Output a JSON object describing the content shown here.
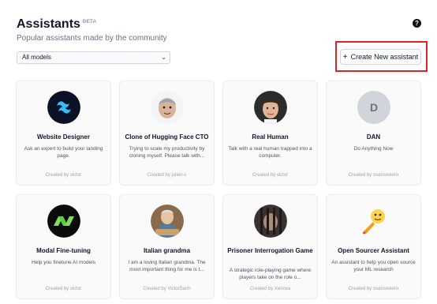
{
  "header": {
    "title": "Assistants",
    "badge": "BETA",
    "subtitle": "Popular assistants made by the community"
  },
  "help_icon": "?",
  "filter": {
    "selected": "All models"
  },
  "create_button": {
    "label": "Create New assistant"
  },
  "cards": [
    {
      "name": "Website Designer",
      "desc": "Ask an expert to build your landing page.",
      "creator": "Created by victor",
      "icon": "tailwind-logo"
    },
    {
      "name": "Clone of Hugging Face CTO",
      "desc": "Trying to scale my productivity by cloning myself. Please talk with...",
      "creator": "Created by julien-c",
      "icon": "memoji-avatar"
    },
    {
      "name": "Real Human",
      "desc": "Talk with a real human trapped into a computer.",
      "creator": "Created by victor",
      "icon": "portrait-photo"
    },
    {
      "name": "DAN",
      "desc": "Do Anything Now",
      "creator": "Created by osanseviero",
      "icon": "letter-avatar",
      "letter": "D"
    },
    {
      "name": "Modal Fine-tuning",
      "desc": "Help you finetune AI models",
      "creator": "Created by victor",
      "icon": "modal-logo"
    },
    {
      "name": "Italian grandma",
      "desc": "I am a loving Italian grandma. The most important thing for me is t...",
      "creator": "Created by VictorSanh",
      "icon": "grandma-photo"
    },
    {
      "name": "Prisoner Interrogation Game",
      "desc": "A strategic role-playing game where players take on the role o...",
      "creator": "Created by Xenova",
      "icon": "prisoner-image"
    },
    {
      "name": "Open Sourcer Assistant",
      "desc": "An assistant to help you open source your ML research",
      "creator": "Created by osanseviero",
      "icon": "rocket-hug-emoji"
    }
  ],
  "colors": {
    "accent_red": "#dc2626",
    "card_bg": "#fafafa"
  }
}
